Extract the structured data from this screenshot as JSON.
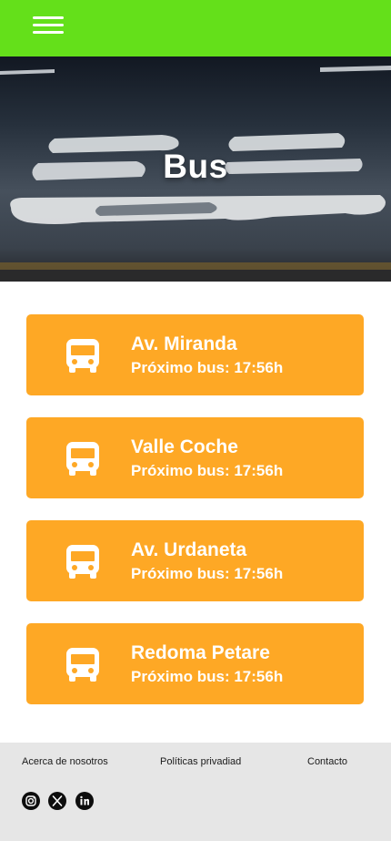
{
  "header": {
    "menu_icon": "hamburger-menu-icon",
    "bar_color": "#64e01a"
  },
  "hero": {
    "title": "Bus"
  },
  "stops": [
    {
      "name": "Av. Miranda",
      "next": "Próximo bus: 17:56h",
      "icon": "bus-icon"
    },
    {
      "name": "Valle Coche",
      "next": "Próximo bus: 17:56h",
      "icon": "bus-icon"
    },
    {
      "name": "Av. Urdaneta",
      "next": "Próximo bus: 17:56h",
      "icon": "bus-icon"
    },
    {
      "name": "Redoma Petare",
      "next": "Próximo bus: 17:56h",
      "icon": "bus-icon"
    }
  ],
  "footer": {
    "links": {
      "about": "Acerca de nosotros",
      "privacy": "Políticas privadiad",
      "contact": "Contacto"
    },
    "social": [
      "instagram-icon",
      "x-icon",
      "linkedin-icon"
    ]
  },
  "colors": {
    "accent": "#fea825",
    "footer_bg": "#e6e6e6"
  }
}
